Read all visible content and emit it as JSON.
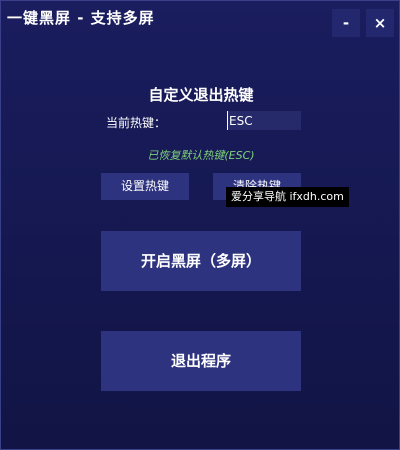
{
  "window": {
    "title": "一键黑屏 - 支持多屏",
    "minimize_label": "-",
    "close_label": "×"
  },
  "hotkey_section": {
    "heading": "自定义退出热键",
    "current_label": "当前热键：",
    "current_value": "ESC",
    "restored_message": "已恢复默认热键(ESC)",
    "set_button": "设置热键",
    "clear_button": "清除热键"
  },
  "actions": {
    "start_blackout": "开启黑屏（多屏）",
    "exit_program": "退出程序"
  },
  "watermark": {
    "text": "爱分享导航 ifxdh.com"
  }
}
